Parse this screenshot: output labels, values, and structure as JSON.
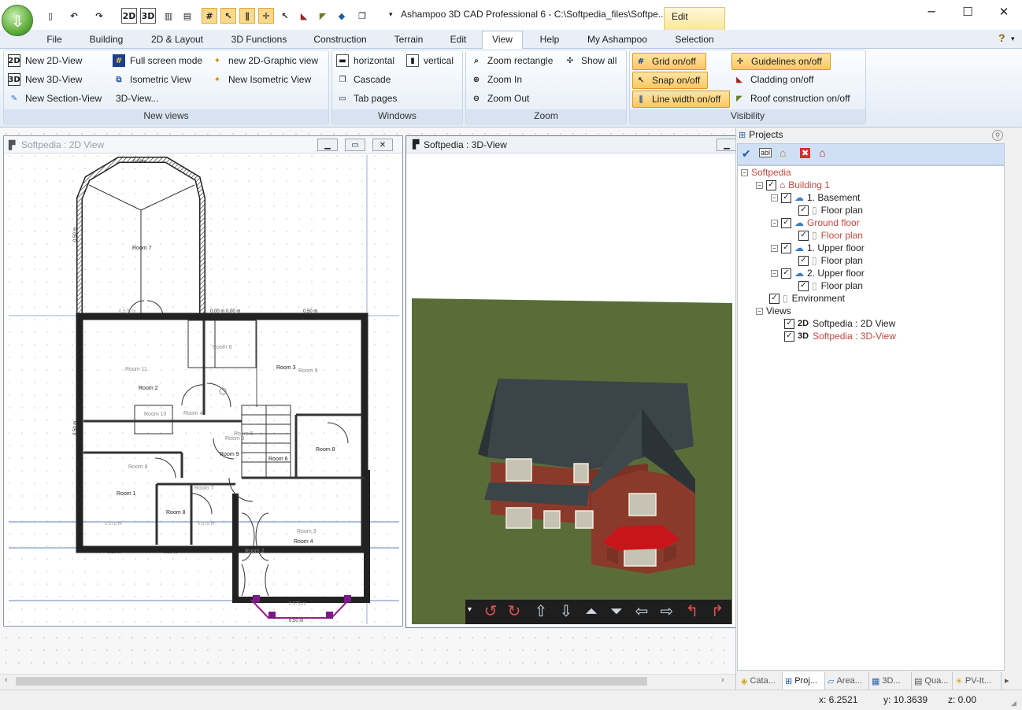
{
  "window": {
    "title": "Ashampoo 3D CAD Professional 6 - C:\\Softpedia_files\\Softpe...",
    "context_tab": "Edit",
    "controls": {
      "minimize": "─",
      "maximize": "☐",
      "close": "✕"
    }
  },
  "quick_access": [
    "2D",
    "3D"
  ],
  "menu": {
    "tabs": [
      "File",
      "Building",
      "2D & Layout",
      "3D Functions",
      "Construction",
      "Terrain",
      "Edit",
      "View",
      "Help",
      "My Ashampoo",
      "Selection"
    ],
    "active": "View",
    "help_icon": "?"
  },
  "ribbon": {
    "new_views": {
      "label": "New views",
      "items": [
        "New 2D-View",
        "Full screen mode",
        "new 2D-Graphic view",
        "New 3D-View",
        "Isometric View",
        "New Isometric View",
        "New Section-View",
        "3D-View..."
      ]
    },
    "windows": {
      "label": "Windows",
      "items": [
        "horizontal",
        "vertical",
        "Cascade",
        "Tab pages"
      ]
    },
    "zoom": {
      "label": "Zoom",
      "items": [
        "Zoom rectangle",
        "Show all",
        "Zoom In",
        "Zoom Out"
      ]
    },
    "visibility": {
      "label": "Visibility",
      "items": [
        "Grid on/off",
        "Guidelines on/off",
        "Snap on/off",
        "Cladding on/off",
        "Line width on/off",
        "Roof construction on/off"
      ]
    }
  },
  "view2d": {
    "title": "Softpedia : 2D View",
    "rooms": [
      "Room 7",
      "Room 11",
      "Room 2",
      "Room 6",
      "Room 3",
      "Room 9",
      "Room 10",
      "Room 4",
      "Room 5",
      "Room 3",
      "Room 9",
      "Room 8",
      "Room 1",
      "Room 8",
      "Room 3",
      "Room 4",
      "Room 2",
      "Room 7",
      "Room 8",
      "Room 6"
    ],
    "dims": [
      "0.50m",
      "0.00 m 0.00 m",
      "0.50 m",
      "0.50 m",
      "0.50 m",
      "0.50 m",
      "0.50 m",
      "0.50 m",
      "0.575 m",
      "0.575 m",
      "0.575 m",
      "0.575 m"
    ]
  },
  "view3d": {
    "title": "Softpedia : 3D-View"
  },
  "projects": {
    "title": "Projects",
    "toolbar": [
      "✔",
      "abl",
      "⌂",
      "✖",
      "⌂"
    ],
    "tree": {
      "root": "Softpedia",
      "building": "Building 1",
      "floors": [
        {
          "name": "1. Basement",
          "plan": "Floor plan",
          "highlight": false
        },
        {
          "name": "Ground floor",
          "plan": "Floor plan",
          "highlight": true
        },
        {
          "name": "1. Upper floor",
          "plan": "Floor plan",
          "highlight": false
        },
        {
          "name": "2. Upper floor",
          "plan": "Floor plan",
          "highlight": false
        }
      ],
      "environment": "Environment",
      "views_label": "Views",
      "views": [
        {
          "prefix": "2D",
          "name": "Softpedia : 2D View",
          "highlight": false
        },
        {
          "prefix": "3D",
          "name": "Softpedia : 3D-View",
          "highlight": true
        }
      ]
    },
    "bottom_tabs": [
      "Cata...",
      "Proj...",
      "Area...",
      "3D...",
      "Qua...",
      "PV-It..."
    ],
    "active_tab": "Proj..."
  },
  "status": {
    "x": "x: 6.2521",
    "y": "y: 10.3639",
    "z": "z: 0.00"
  },
  "colors": {
    "accent": "#f9c860",
    "highlight_text": "#c8473f",
    "ribbon_bg": "#e3ebf6",
    "grass": "#5a6d38",
    "roof": "#3b4448",
    "brick": "#8a3a2b",
    "bay_roof": "#c8151a"
  }
}
